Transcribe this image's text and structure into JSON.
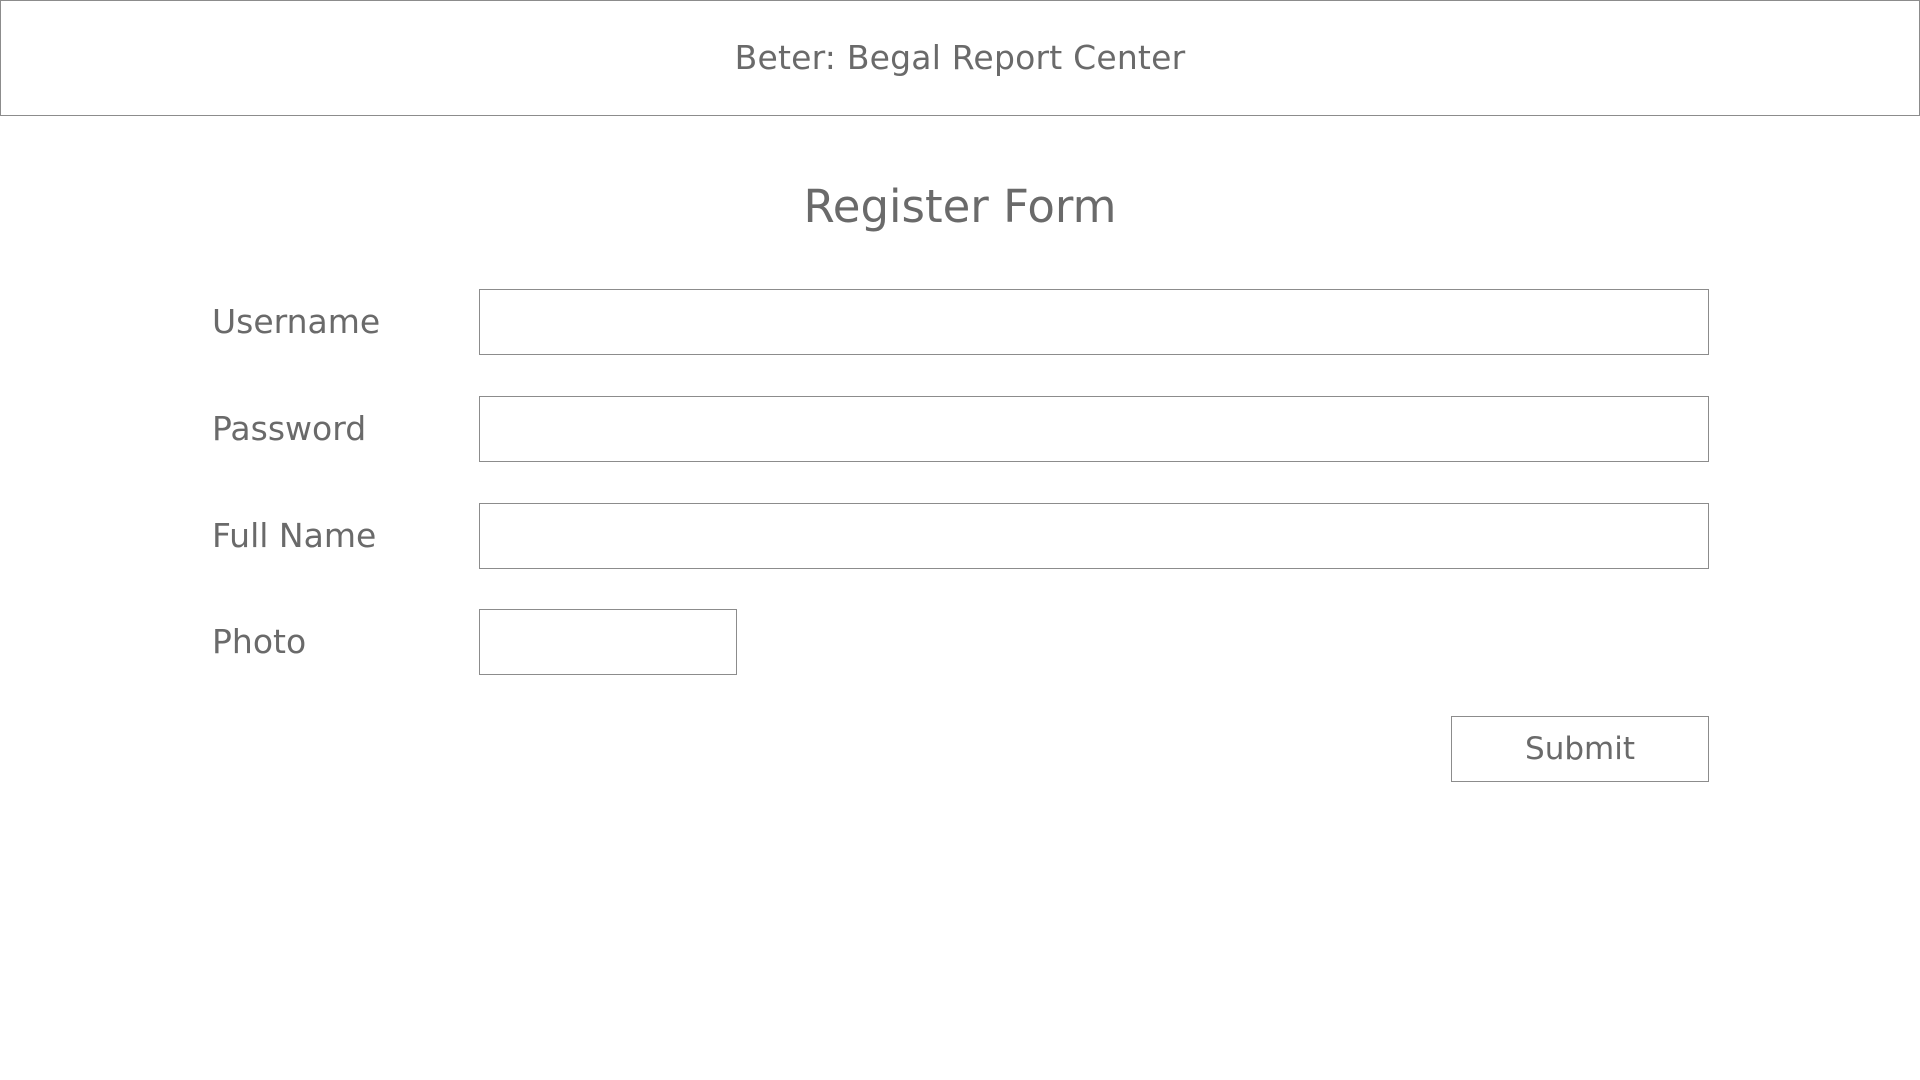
{
  "header": {
    "title": "Beter: Begal Report Center"
  },
  "form": {
    "title": "Register Form",
    "fields": [
      {
        "label": "Username",
        "value": "",
        "placeholder": ""
      },
      {
        "label": "Password",
        "value": "",
        "placeholder": ""
      },
      {
        "label": "Full Name",
        "value": "",
        "placeholder": ""
      },
      {
        "label": "Photo",
        "value": ""
      }
    ],
    "submit_label": "Submit"
  },
  "colors": {
    "text": "#6a6a6a",
    "border": "#8c8c8c",
    "background": "#ffffff"
  }
}
